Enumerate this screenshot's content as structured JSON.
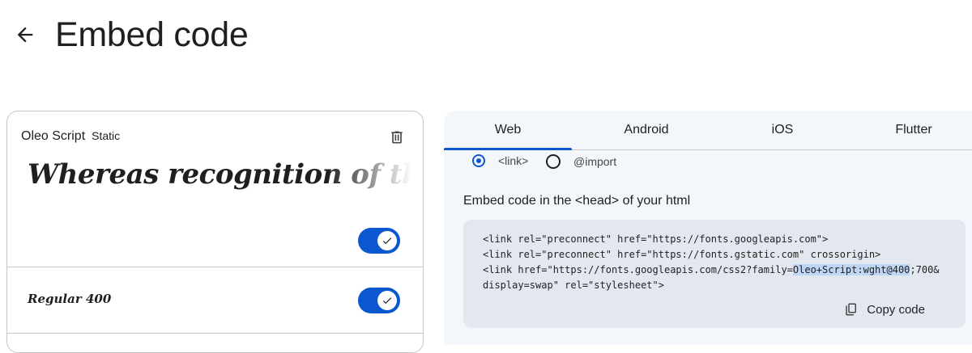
{
  "header": {
    "back_icon": "arrow-back-icon",
    "title": "Embed code"
  },
  "font_card": {
    "family": "Oleo Script",
    "type": "Static",
    "delete_icon": "trash-icon",
    "preview_text": "Whereas recognition of the inh",
    "family_toggle_on": true,
    "styles": [
      {
        "label": "Regular 400",
        "selected": true
      }
    ]
  },
  "embed": {
    "tabs": [
      {
        "label": "Web",
        "active": true
      },
      {
        "label": "Android",
        "active": false
      },
      {
        "label": "iOS",
        "active": false
      },
      {
        "label": "Flutter",
        "active": false
      }
    ],
    "methods": [
      {
        "label": "<link>",
        "selected": true
      },
      {
        "label": "@import",
        "selected": false
      }
    ],
    "instruction": "Embed code in the <head> of your html",
    "code": {
      "line1": "<link rel=\"preconnect\" href=\"https://fonts.googleapis.com\">",
      "line2": "<link rel=\"preconnect\" href=\"https://fonts.gstatic.com\" crossorigin>",
      "line3_prefix": "<link href=\"https://fonts.googleapis.com/css2?family=",
      "line3_highlight": "Oleo+Script:wght@400",
      "line3_suffix": ";700&",
      "line4": "display=swap\" rel=\"stylesheet\">"
    },
    "copy_label": "Copy code",
    "copy_icon": "copy-icon"
  },
  "colors": {
    "accent": "#0b57d0",
    "panel_bg": "#f3f6fb",
    "code_bg": "#e3e8f0",
    "highlight": "#bfd6f6"
  }
}
